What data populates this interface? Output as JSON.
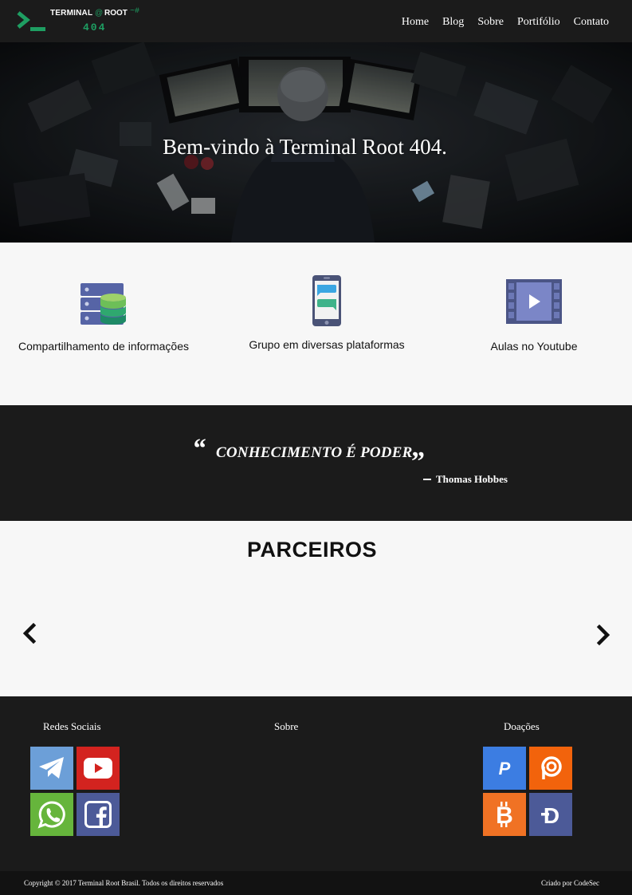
{
  "header": {
    "brand_title": "TERMINAL",
    "brand_at": "@",
    "brand_root": "ROOT",
    "brand_prompt": "~#",
    "brand_number": "404",
    "nav": [
      "Home",
      "Blog",
      "Sobre",
      "Portifólio",
      "Contato"
    ]
  },
  "hero": {
    "title": "Bem-vindo à Terminal Root 404."
  },
  "features": [
    {
      "label": "Compartilhamento de informações",
      "icon": "database-server-icon"
    },
    {
      "label": "Grupo em diversas plataformas",
      "icon": "phone-chat-icon"
    },
    {
      "label": "Aulas no Youtube",
      "icon": "video-play-icon"
    }
  ],
  "quote": {
    "open_mark": "“",
    "text": "CONHECIMENTO É PODER",
    "close_mark": "”",
    "author": "Thomas Hobbes"
  },
  "partners": {
    "title": "PARCEIROS",
    "prev_icon": "chevron-left-icon",
    "next_icon": "chevron-right-icon"
  },
  "footer": {
    "social_heading": "Redes Sociais",
    "about_heading": "Sobre",
    "donations_heading": "Doações",
    "social": [
      {
        "name": "telegram-icon",
        "color": "#6c9fd8"
      },
      {
        "name": "youtube-icon",
        "color": "#d3231f"
      },
      {
        "name": "whatsapp-icon",
        "color": "#66b53c"
      },
      {
        "name": "facebook-icon",
        "color": "#4c5a98"
      }
    ],
    "donations": [
      {
        "name": "paypal-icon",
        "color": "#3c7de2"
      },
      {
        "name": "patreon-icon",
        "color": "#f2630c"
      },
      {
        "name": "bitcoin-icon",
        "color": "#f07224"
      },
      {
        "name": "dash-coin-icon",
        "color": "#4c5a98"
      }
    ]
  },
  "bottom": {
    "copyright": "Copyright © 2017 Terminal Root Brasil. Todos os direitos reservados",
    "credit": "Criado por CodeSec"
  },
  "colors": {
    "accent": "#1e9e62",
    "dark_bg": "#1b1b1b",
    "light_bg": "#f7f7f7"
  }
}
